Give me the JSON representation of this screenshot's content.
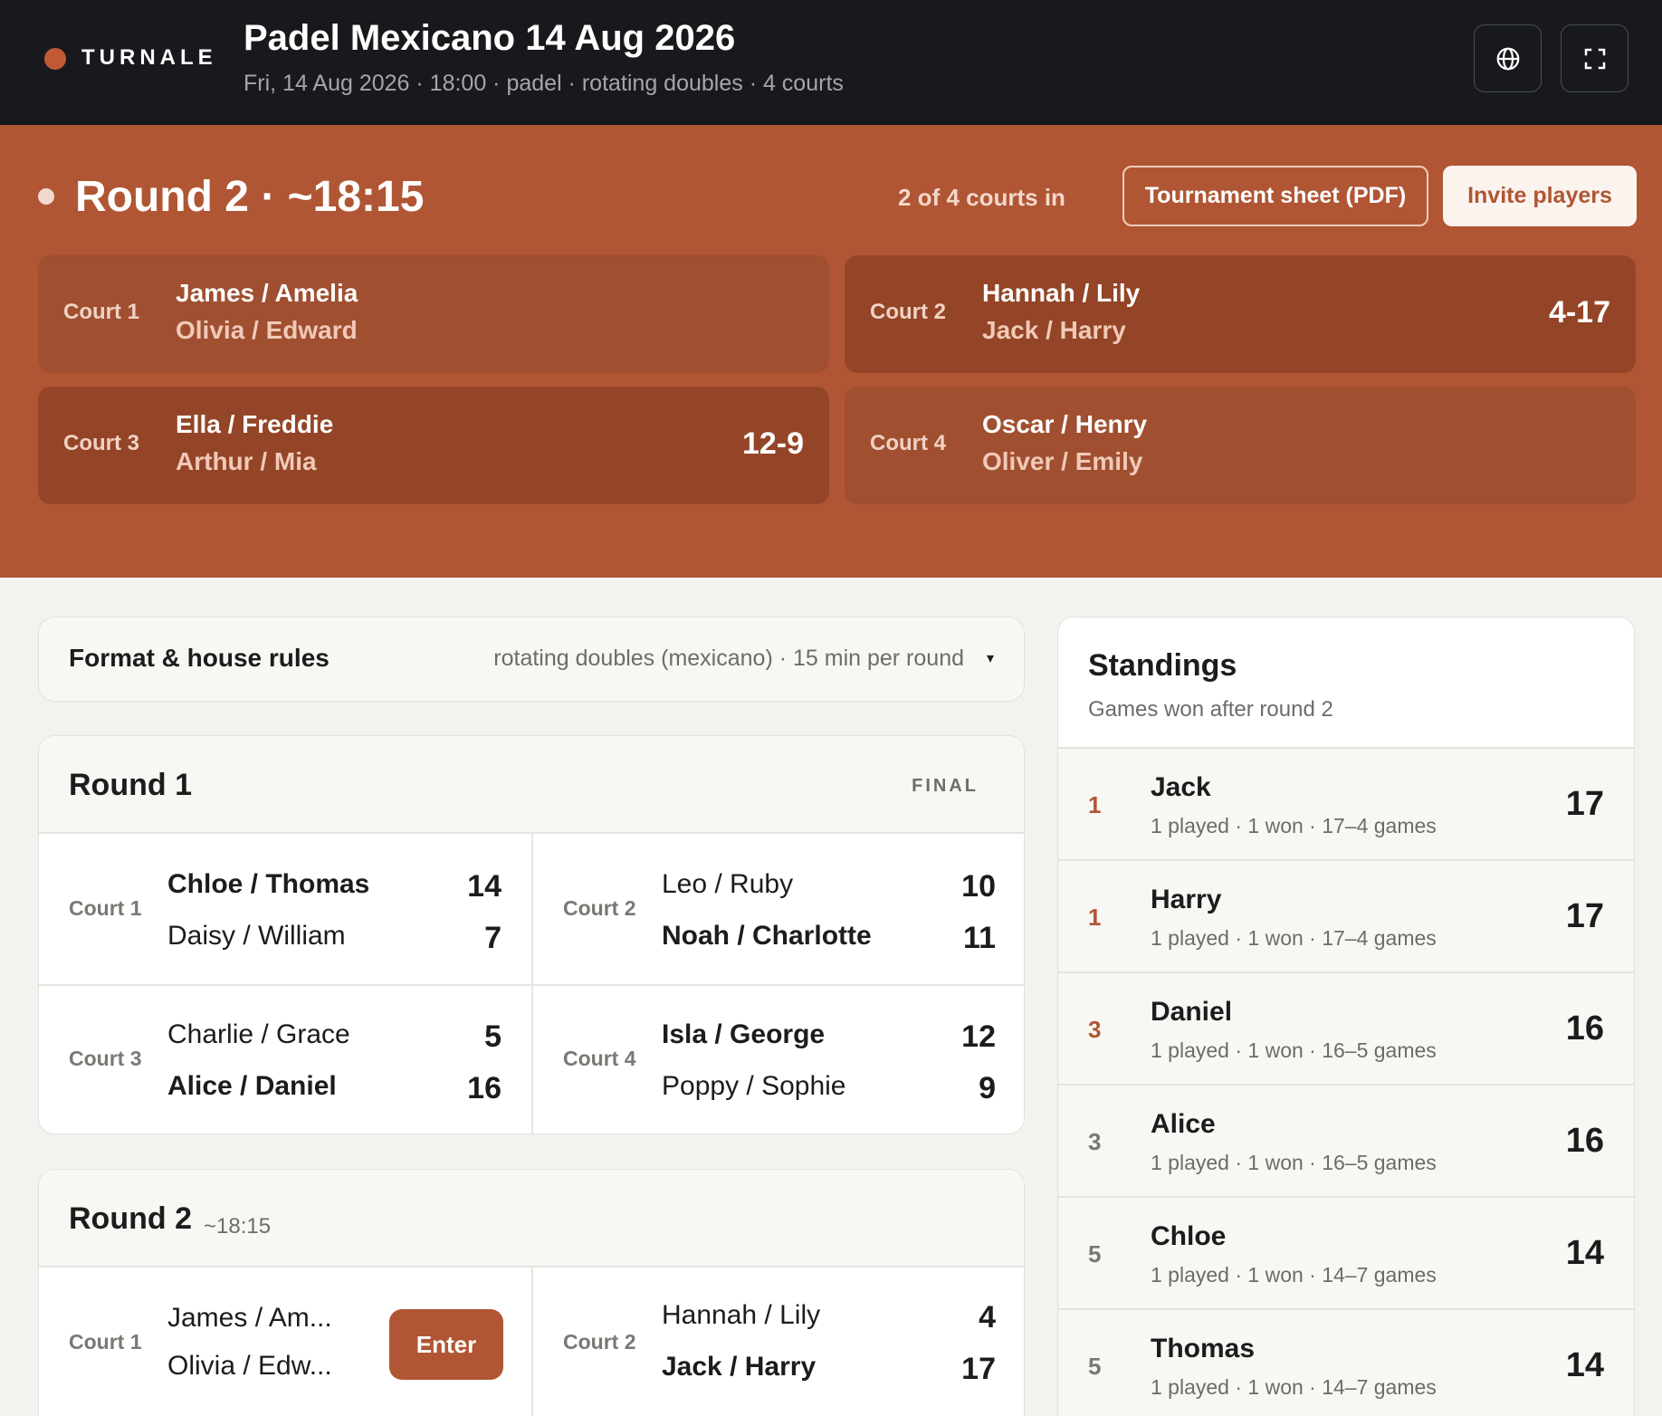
{
  "header": {
    "brand": "TURNALE",
    "title": "Padel Mexicano 14 Aug 2026",
    "subtitle": "Fri, 14 Aug 2026 · 18:00 · padel · rotating doubles · 4 courts",
    "icons": [
      "globe-icon",
      "fullscreen-icon"
    ]
  },
  "live": {
    "round_label": "Round 2 · ~18:15",
    "courts_in": "2 of 4 courts in",
    "sheet_button": "Tournament sheet (PDF)",
    "invite_button": "Invite players",
    "courts": [
      {
        "label": "Court 1",
        "team1": "James / Amelia",
        "team2": "Olivia / Edward",
        "score": ""
      },
      {
        "label": "Court 2",
        "team1": "Hannah / Lily",
        "team2": "Jack / Harry",
        "score": "4-17"
      },
      {
        "label": "Court 3",
        "team1": "Ella / Freddie",
        "team2": "Arthur / Mia",
        "score": "12-9"
      },
      {
        "label": "Court 4",
        "team1": "Oscar / Henry",
        "team2": "Oliver / Emily",
        "score": ""
      }
    ]
  },
  "format": {
    "title": "Format & house rules",
    "meta": "rotating doubles (mexicano) · 15 min per round",
    "caret": "▾"
  },
  "rounds": [
    {
      "title": "Round 1",
      "time": "",
      "status": "FINAL",
      "matches": [
        {
          "label": "Court 1",
          "team1": "Chloe / Thomas",
          "team2": "Daisy / William",
          "score1": "14",
          "score2": "7"
        },
        {
          "label": "Court 2",
          "team1": "Leo / Ruby",
          "team2": "Noah / Charlotte",
          "score1": "10",
          "score2": "11"
        },
        {
          "label": "Court 3",
          "team1": "Charlie / Grace",
          "team2": "Alice / Daniel",
          "score1": "5",
          "score2": "16"
        },
        {
          "label": "Court 4",
          "team1": "Isla / George",
          "team2": "Poppy / Sophie",
          "score1": "12",
          "score2": "9"
        }
      ]
    },
    {
      "title": "Round 2",
      "time": "~18:15",
      "status": "",
      "enter_button": "Enter",
      "matches": [
        {
          "label": "Court 1",
          "team1": "James / Am...",
          "team2": "Olivia / Edw...",
          "score1": "",
          "score2": ""
        },
        {
          "label": "Court 2",
          "team1": "Hannah / Lily",
          "team2": "Jack / Harry",
          "score1": "4",
          "score2": "17"
        }
      ]
    }
  ],
  "standings": {
    "title": "Standings",
    "subtitle": "Games won after round 2",
    "rows": [
      {
        "rank": "1",
        "name": "Jack",
        "stats": "1 played · 1 won · 17–4 games",
        "points": "17"
      },
      {
        "rank": "1",
        "name": "Harry",
        "stats": "1 played · 1 won · 17–4 games",
        "points": "17"
      },
      {
        "rank": "3",
        "name": "Daniel",
        "stats": "1 played · 1 won · 16–5 games",
        "points": "16"
      },
      {
        "rank": "3",
        "name": "Alice",
        "stats": "1 played · 1 won · 16–5 games",
        "points": "16"
      },
      {
        "rank": "5",
        "name": "Chloe",
        "stats": "1 played · 1 won · 14–7 games",
        "points": "14"
      },
      {
        "rank": "5",
        "name": "Thomas",
        "stats": "1 played · 1 won · 14–7 games",
        "points": "14"
      }
    ]
  },
  "colors": {
    "accent": "#b05634",
    "topbar": "#17191c",
    "background": "#f3f2ef"
  }
}
